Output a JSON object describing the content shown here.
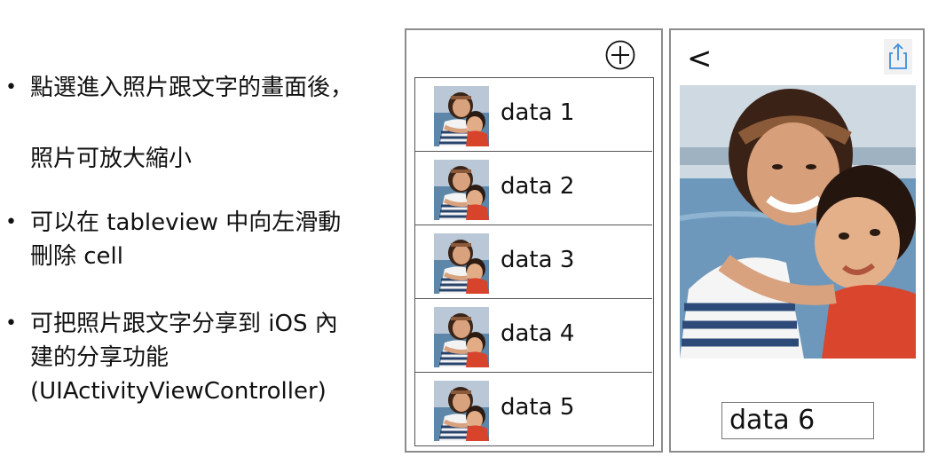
{
  "bullets": {
    "b1_line1": "點選進入照片跟文字的畫面後，",
    "b1_line2": "照片可放大縮小",
    "b2": "可以在 tableview 中向左滑動\n刪除 cell",
    "b3": "可把照片跟文字分享到 iOS 內\n建的分享功能\n(UIActivityViewController)",
    "dot": "•"
  },
  "list_screen": {
    "add_icon": "plus-circle-icon",
    "rows": [
      "data 1",
      "data 2",
      "data 3",
      "data 4",
      "data 5"
    ]
  },
  "detail_screen": {
    "back_label": "<",
    "share_icon": "share-icon",
    "caption_value": "data 6"
  },
  "colors": {
    "frame": "#8c8c8c",
    "share_blue": "#3d8fe0"
  }
}
